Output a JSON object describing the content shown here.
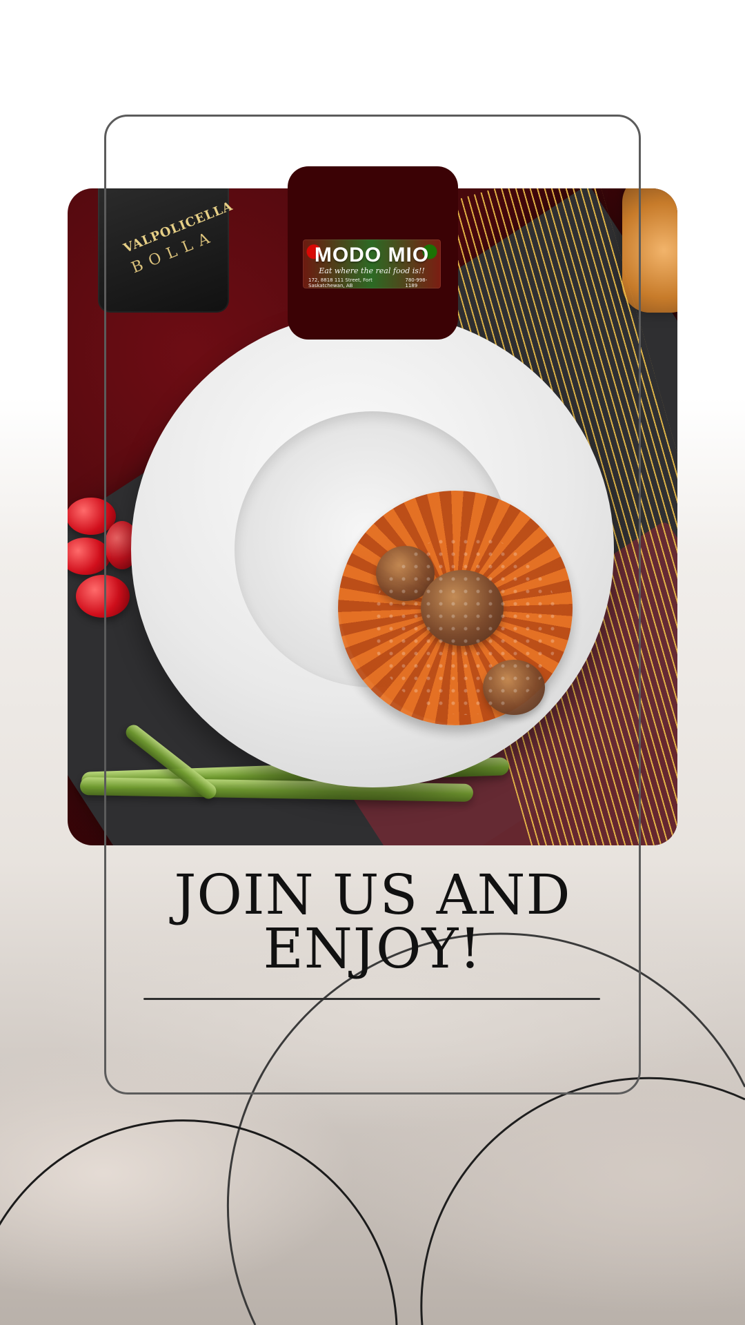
{
  "logo": {
    "title": "MODO MIO",
    "tagline": "Eat where the real food is!!",
    "address": "172, 8818 111 Street, Fort Saskatchewan, AB",
    "phone": "780-998-1189"
  },
  "photo": {
    "bottle_label_line1": "VALPOLICELLA",
    "bottle_label_line2": "BOLLA"
  },
  "headline": {
    "line1": "JOIN US AND",
    "line2": "ENJOY!"
  }
}
